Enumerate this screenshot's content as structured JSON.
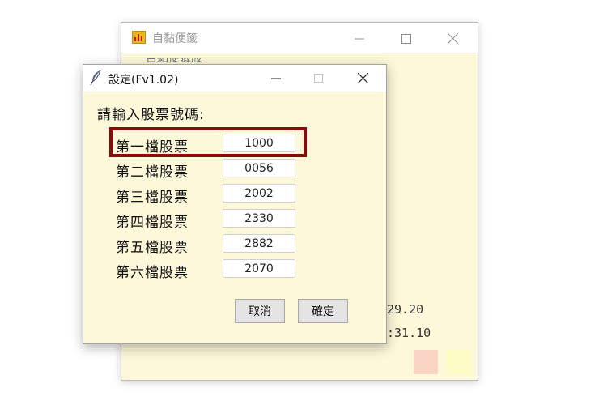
{
  "background_window": {
    "title": "自黏便籤",
    "title_partial": "自黏便籤股",
    "price_line_1": "29.20",
    "price_line_2": ":31.10",
    "colors": {
      "swatch_1": "#fad4c4",
      "swatch_2": "#fdfcc5",
      "note_bg": "#fdf8d9"
    }
  },
  "dialog": {
    "title": "設定(Fv1.02)",
    "prompt": "請輸入股票號碼:",
    "stocks": [
      {
        "label": "第一檔股票",
        "value": "1000"
      },
      {
        "label": "第二檔股票",
        "value": "0056"
      },
      {
        "label": "第三檔股票",
        "value": "2002"
      },
      {
        "label": "第四檔股票",
        "value": "2330"
      },
      {
        "label": "第五檔股票",
        "value": "2882"
      },
      {
        "label": "第六檔股票",
        "value": "2070"
      }
    ],
    "cancel_label": "取消",
    "confirm_label": "確定",
    "highlight_color": "#8b0a0a"
  },
  "icons": {
    "app": "app-chart-icon",
    "dialog": "feather-icon",
    "minimize": "minimize-icon",
    "maximize": "maximize-icon",
    "close": "close-icon"
  }
}
